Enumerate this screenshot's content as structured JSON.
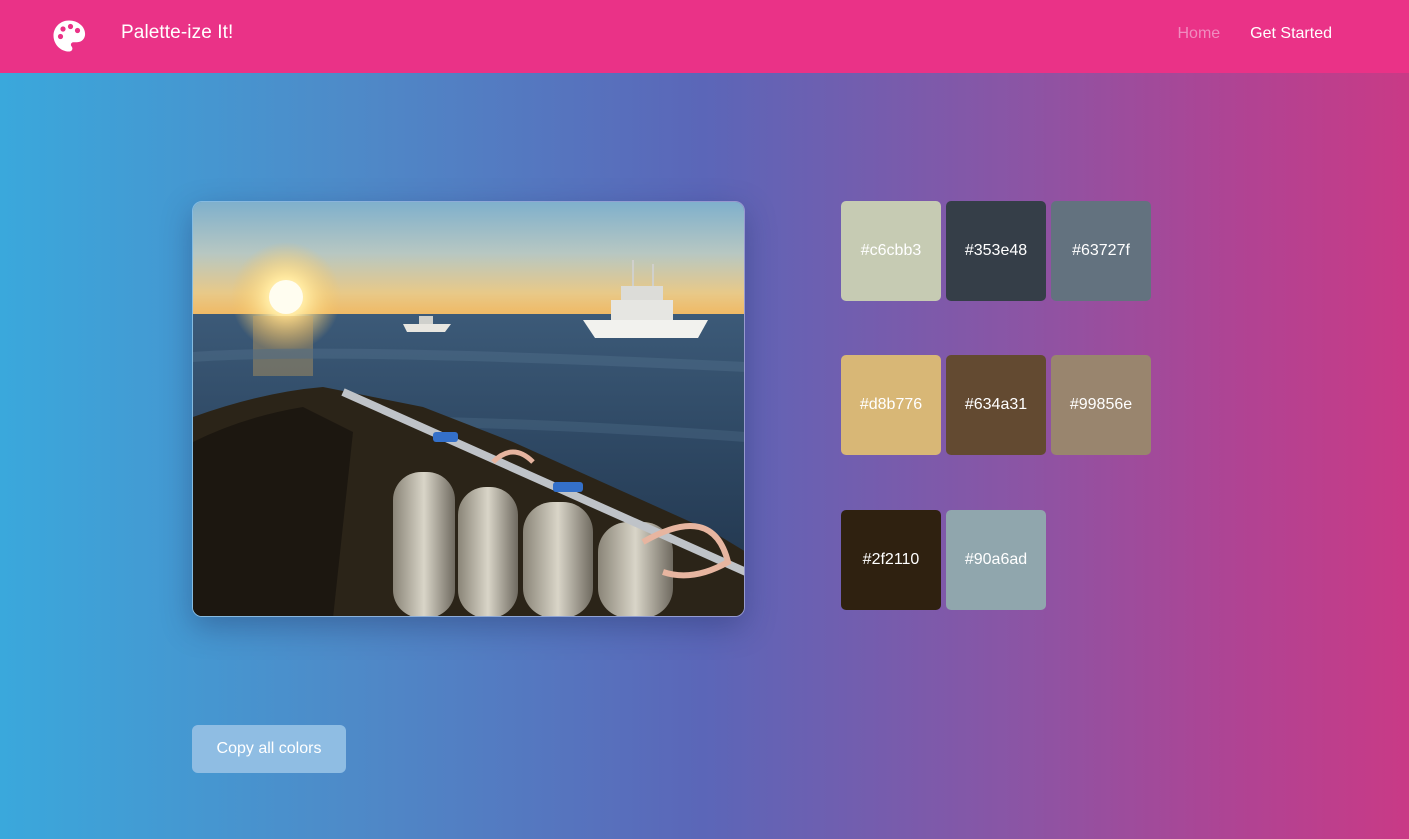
{
  "navbar": {
    "brand": "Palette-ize It!",
    "links": [
      {
        "label": "Home",
        "active": false
      },
      {
        "label": "Get Started",
        "active": true
      }
    ],
    "background": "#ea3287",
    "logo_icon": "palette-icon"
  },
  "photo": {
    "alt": "Sunset over the ocean with dive boats and scuba tanks"
  },
  "palette": [
    {
      "hex": "#c6cbb3"
    },
    {
      "hex": "#353e48"
    },
    {
      "hex": "#63727f"
    },
    {
      "hex": "#d8b776"
    },
    {
      "hex": "#634a31"
    },
    {
      "hex": "#99856e"
    },
    {
      "hex": "#2f2110"
    },
    {
      "hex": "#90a6ad"
    }
  ],
  "actions": {
    "copy_label": "Copy all colors"
  }
}
